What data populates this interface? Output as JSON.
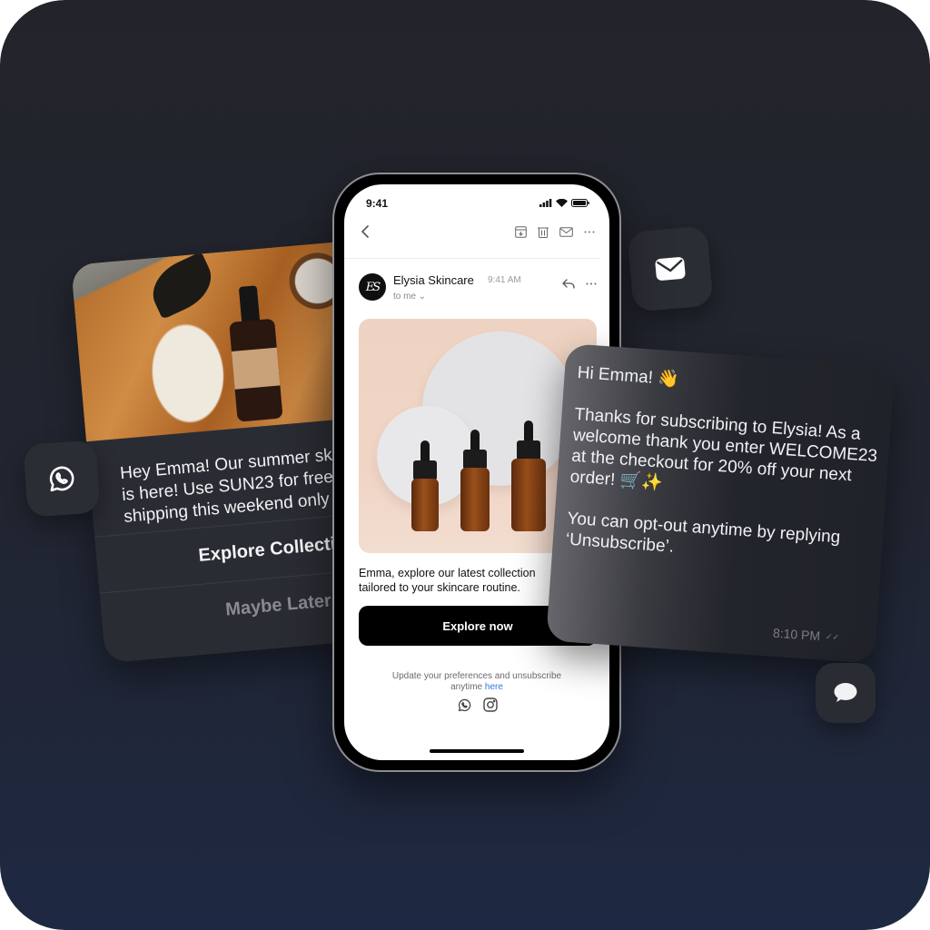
{
  "phone": {
    "status_time": "9:41",
    "email": {
      "sender_initials": "ES",
      "sender_name": "Elysia Skincare",
      "sent_time": "9:41 AM",
      "recipient": "to me",
      "body_line1": "Emma, explore our latest collection",
      "body_line2": "tailored to your skincare routine.",
      "cta_label": "Explore now",
      "footer_text": "Update your preferences and unsubscribe",
      "footer_text2": "anytime",
      "footer_link": "here"
    }
  },
  "whatsapp_card": {
    "message_line1": "Hey Emma! Our summer skincare",
    "message_line2": "is here! Use SUN23 for free",
    "message_line3": "shipping this weekend only",
    "primary_button": "Explore Collection",
    "secondary_button": "Maybe Later"
  },
  "sms_card": {
    "greeting": "Hi Emma! 👋",
    "paragraph1": "Thanks for subscribing to Elysia! As a welcome thank you enter WELCOME23 at the checkout for 20% off your next order! 🛒✨",
    "paragraph2": "You can opt-out anytime by replying ‘Unsubscribe’.",
    "time": "8:10 PM",
    "read_receipt": "✓✓"
  },
  "icons": {
    "mail_tile": "mail-icon",
    "whatsapp_tile": "whatsapp-icon",
    "chat_tile": "chat-bubble-icon"
  }
}
